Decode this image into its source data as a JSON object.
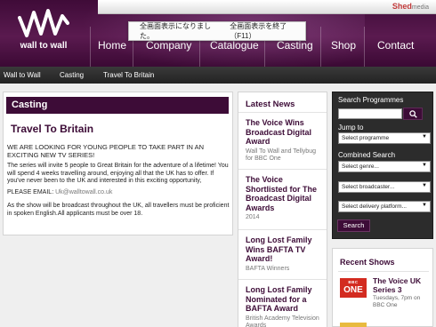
{
  "header": {
    "logo_text": "wall to wall",
    "sponsor_name": "Shed",
    "sponsor_suffix": "media",
    "nav": [
      "Home",
      "Company",
      "Catalogue",
      "Casting",
      "Shop",
      "Contact"
    ]
  },
  "fullscreen_notice": {
    "message": "全画面表示になりました。",
    "exit_hint": "全画面表示を終了（F11）"
  },
  "breadcrumb": [
    "Wall to Wall",
    "Casting",
    "Travel To Britain"
  ],
  "main": {
    "section_title": "Casting",
    "article_title": "Travel To Britain",
    "lead": "WE ARE LOOKING FOR YOUNG PEOPLE TO TAKE PART IN AN EXCITING NEW TV SERIES!",
    "para1": "The series will invite 5 people to Great Britain for the adventure of a lifetime! You will spend 4 weeks travelling around, enjoying all that the UK has to offer. If you've never been to the UK and interested in this exciting opportunity,",
    "email_label": "PLEASE EMAIL:",
    "email": "Uk@walltowall.co.uk",
    "para2": "As the show will be broadcast throughout the UK, all travellers must be proficient in spoken English.All applicants must be over 18."
  },
  "news": {
    "heading": "Latest News",
    "items": [
      {
        "title": "The Voice Wins Broadcast Digital Award",
        "sub": "Wall To Wall and Tellybug for BBC One"
      },
      {
        "title": "The Voice Shortlisted for The Broadcast Digital Awards",
        "sub": "2014"
      },
      {
        "title": "Long Lost Family Wins BAFTA TV Award!",
        "sub": "BAFTA Winners"
      },
      {
        "title": "Long Lost Family Nominated for a BAFTA Award",
        "sub": "British Academy Television Awards"
      }
    ]
  },
  "sidebar": {
    "search_label": "Search Programmes",
    "search_value": "",
    "jump_label": "Jump to",
    "jump_select": "Select programme",
    "combined_label": "Combined Search",
    "genre_select": "Select genre...",
    "broadcaster_select": "Select broadcaster...",
    "platform_select": "Select delivery platform...",
    "search_button": "Search"
  },
  "recent": {
    "heading": "Recent Shows",
    "logo_top": "BBC",
    "logo_main": "ONE",
    "show_title": "The Voice UK Series 3",
    "show_time": "Tuesdays, 7pm on",
    "show_channel": "BBC One"
  },
  "colors": {
    "brand_purple": "#3d0c37",
    "bbc_red": "#d32b20"
  }
}
